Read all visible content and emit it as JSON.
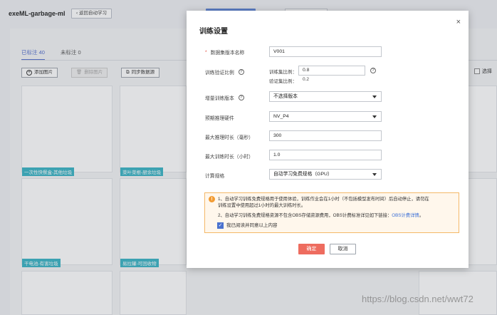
{
  "background": {
    "app_title": "exeML-garbage-ml",
    "back_button": "返回自动学习",
    "tabs": [
      {
        "label": "已标注 40",
        "active": true
      },
      {
        "label": "未标注 0",
        "active": false
      }
    ],
    "toolbar": {
      "add_image": "添加图片",
      "delete_image": "删除图片",
      "sync_source": "同步数据源",
      "select_all": "选择"
    },
    "card_tags": [
      "一次性快餐盒-其他垃圾",
      "菜叶菜根-厨余垃圾",
      "干电池-有害垃圾",
      "易拉罐-可回收物"
    ]
  },
  "dialog": {
    "title": "训练设置",
    "close_label": "×",
    "fields": {
      "dataset_version": {
        "label": "数据集版本名称",
        "value": "V001"
      },
      "train_split": {
        "label": "训练验证比例",
        "train_label": "训练集比例：",
        "train_value": "0.8",
        "val_label": "验证集比例：",
        "val_value": "0.2"
      },
      "incremental_version": {
        "label": "增量训练版本",
        "value": "不选择版本"
      },
      "inference_hardware": {
        "label": "预期推理硬件",
        "value": "NV_P4"
      },
      "max_inference_time": {
        "label": "最大推理时长（毫秒）",
        "value": "300"
      },
      "max_training_time": {
        "label": "最大训练时长（小时）",
        "value": "1.0"
      },
      "compute_spec": {
        "label": "计算规格",
        "value": "自动学习免费规格（GPU）"
      }
    },
    "notice": {
      "line1": "1、自动学习训练免费规格用于使用体验，训练作业会在1小时（不包括模型发布时间）后自动停止，请勿在",
      "line2": "训练设置中使用超过1小时的最大训练时长。",
      "line3": "2、自动学习训练免费规格资源不包含OBS存储资源费用，OBS计费标准详见如下链接：",
      "link": "OBS计费详情",
      "line3_end": "。",
      "agree": "我已阅读并同意以上内容",
      "agreed": true
    },
    "buttons": {
      "confirm": "确定",
      "cancel": "取消"
    }
  },
  "watermark": "https://blog.csdn.net/wwt72"
}
